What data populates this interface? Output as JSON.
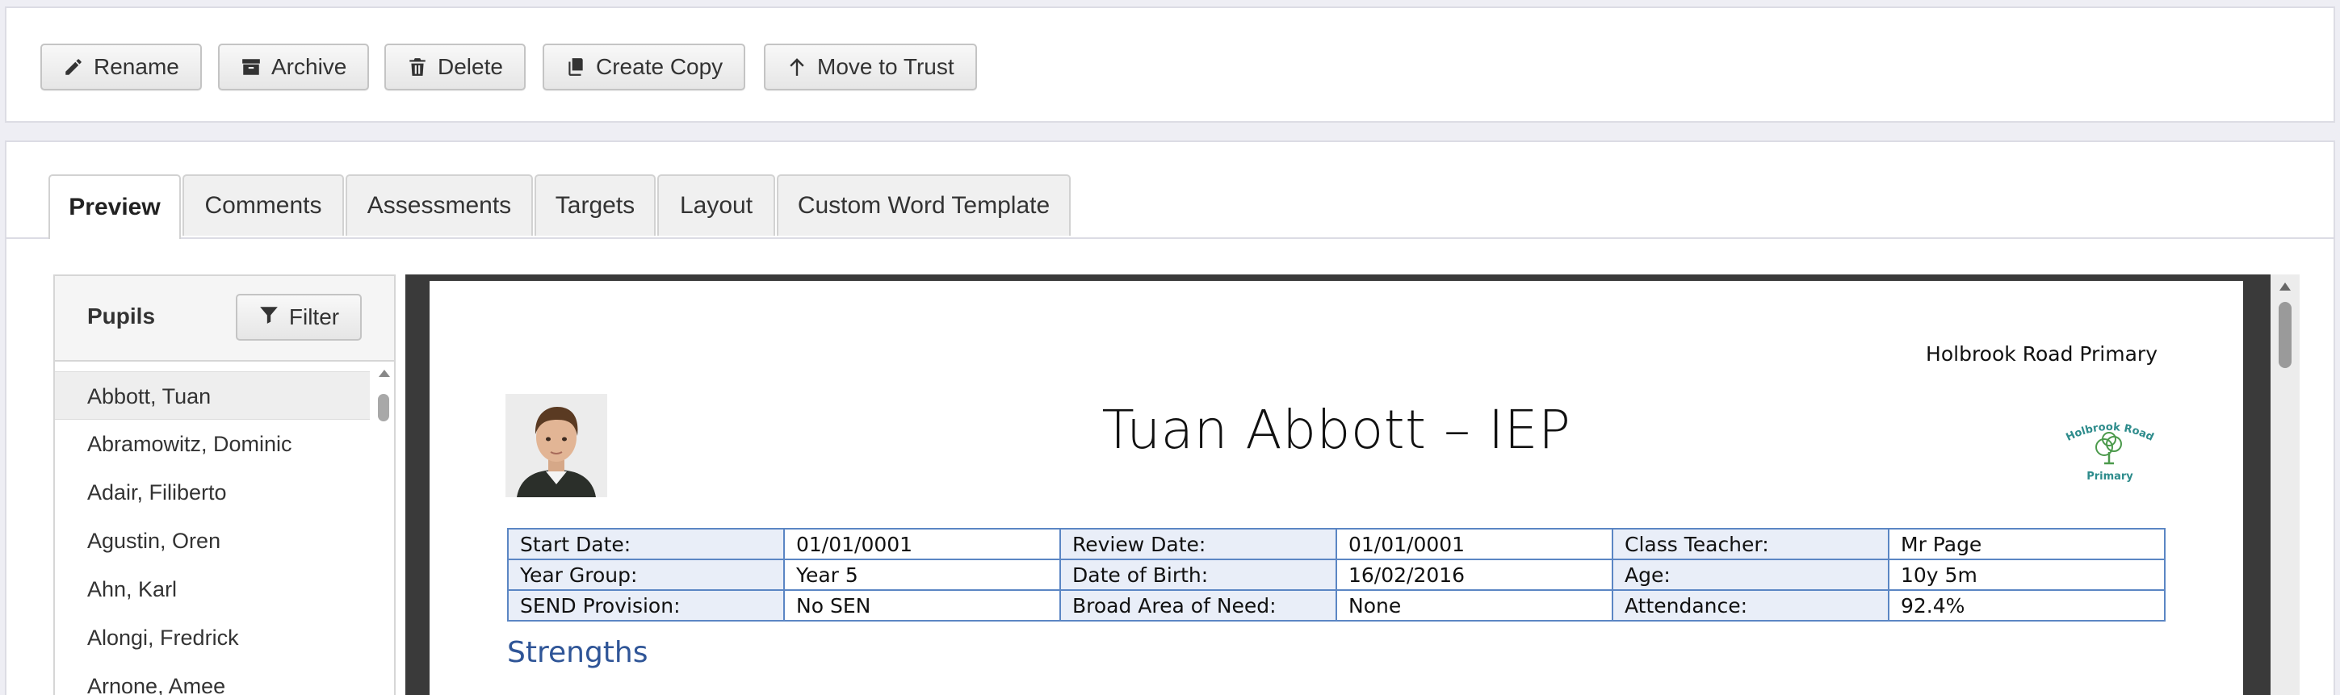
{
  "toolbar": {
    "buttons": [
      {
        "label": "Rename",
        "icon": "pencil-icon"
      },
      {
        "label": "Archive",
        "icon": "archive-icon"
      },
      {
        "label": "Delete",
        "icon": "trash-icon"
      },
      {
        "label": "Create Copy",
        "icon": "copy-icon"
      },
      {
        "label": "Move to Trust",
        "icon": "arrow-up-icon"
      }
    ]
  },
  "tabs": [
    "Preview",
    "Comments",
    "Assessments",
    "Targets",
    "Layout",
    "Custom Word Template"
  ],
  "active_tab": "Preview",
  "pupils": {
    "title": "Pupils",
    "filter_label": "Filter",
    "list": [
      "Abbott, Tuan",
      "Abramowitz, Dominic",
      "Adair, Filiberto",
      "Agustin, Oren",
      "Ahn, Karl",
      "Alongi, Fredrick",
      "Arnone, Amee"
    ],
    "selected": "Abbott, Tuan"
  },
  "document": {
    "school_name": "Holbrook Road Primary",
    "title": "Tuan Abbott – IEP",
    "logo_text": {
      "line1": "Holbrook Road",
      "line2": "Primary"
    },
    "table": [
      [
        {
          "label": "Start Date:",
          "value": "01/01/0001"
        },
        {
          "label": "Review Date:",
          "value": "01/01/0001"
        },
        {
          "label": "Class Teacher:",
          "value": "Mr Page"
        }
      ],
      [
        {
          "label": "Year Group:",
          "value": "Year 5"
        },
        {
          "label": "Date of Birth:",
          "value": "16/02/2016"
        },
        {
          "label": "Age:",
          "value": "10y 5m"
        }
      ],
      [
        {
          "label": "SEND Provision:",
          "value": "No SEN"
        },
        {
          "label": "Broad Area of Need:",
          "value": "None"
        },
        {
          "label": "Attendance:",
          "value": "92.4%"
        }
      ]
    ],
    "section_heading": "Strengths"
  }
}
